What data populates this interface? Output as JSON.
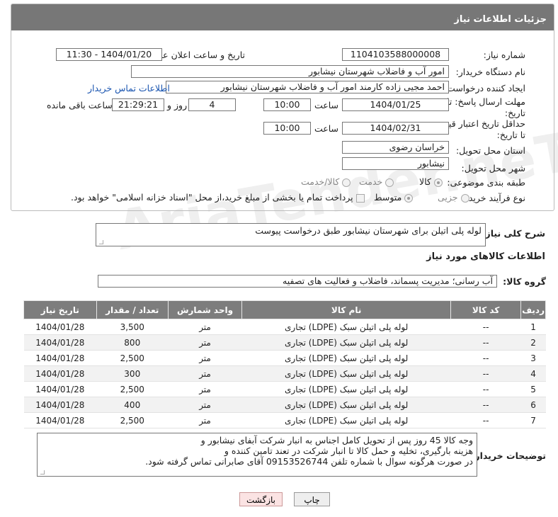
{
  "header": {
    "title": "جزئیات اطلاعات نیاز"
  },
  "fields": {
    "need_number_label": "شماره نیاز:",
    "need_number": "1104103588000008",
    "announce_label": "تاریخ و ساعت اعلان عمومی:",
    "announce_value": "1404/01/20 - 11:30",
    "buyer_org_label": "نام دستگاه خریدار:",
    "buyer_org": "امور آب و فاضلاب شهرستان نیشابور",
    "creator_label": "ایجاد کننده درخواست:",
    "creator": "احمد مجیی زاده کارمند امور آب و فاضلاب شهرستان نیشابور",
    "contact_link": "اطلاعات تماس خریدار",
    "deadline_label_1": "مهلت ارسال پاسخ: تا",
    "deadline_label_2": "تاریخ:",
    "deadline_date": "1404/01/25",
    "time_label": "ساعت",
    "deadline_time": "10:00",
    "days_value": "4",
    "days_label": "روز و",
    "remaining_time": "21:29:21",
    "remaining_label": "ساعت باقی مانده",
    "price_label_1": "حداقل تاریخ اعتبار قیمت:",
    "price_label_2": "تا تاریخ:",
    "price_date": "1404/02/31",
    "price_time": "10:00",
    "province_label": "استان محل تحویل:",
    "province": "خراسان رضوی",
    "city_label": "شهر محل تحویل:",
    "city": "نیشابور",
    "category_label": "طبقه بندی موضوعی:",
    "category_options": [
      "کالا",
      "خدمت",
      "کالا/خدمت"
    ],
    "process_label": "نوع فرآیند خرید :",
    "process_options": [
      "جزیی",
      "متوسط"
    ],
    "payment_note": "پرداخت تمام یا بخشی از مبلغ خرید،از محل \"اسناد خزانه اسلامی\" خواهد بود."
  },
  "description": {
    "label": "شرح کلی نیاز:",
    "text": "لوله پلی اتیلن برای شهرستان نیشابور طبق درخواست پیوست"
  },
  "goods": {
    "section_title": "اطلاعات کالاهای مورد نیاز",
    "group_label": "گروه کالا:",
    "group_value": "آب رسانی؛ مدیریت پسماند، فاضلاب و فعالیت های تصفیه",
    "columns": [
      "ردیف",
      "کد کالا",
      "نام کالا",
      "واحد شمارش",
      "تعداد / مقدار",
      "تاریخ نیاز"
    ],
    "rows": [
      [
        "1",
        "--",
        "لوله پلی اتیلن سبک (LDPE) تجاری",
        "متر",
        "3,500",
        "1404/01/28"
      ],
      [
        "2",
        "--",
        "لوله پلی اتیلن سبک (LDPE) تجاری",
        "متر",
        "800",
        "1404/01/28"
      ],
      [
        "3",
        "--",
        "لوله پلی اتیلن سبک (LDPE) تجاری",
        "متر",
        "2,500",
        "1404/01/28"
      ],
      [
        "4",
        "--",
        "لوله پلی اتیلن سبک (LDPE) تجاری",
        "متر",
        "300",
        "1404/01/28"
      ],
      [
        "5",
        "--",
        "لوله پلی اتیلن سبک (LDPE) تجاری",
        "متر",
        "2,500",
        "1404/01/28"
      ],
      [
        "6",
        "--",
        "لوله پلی اتیلن سبک (LDPE) تجاری",
        "متر",
        "400",
        "1404/01/28"
      ],
      [
        "7",
        "--",
        "لوله پلی اتیلن سبک (LDPE) تجاری",
        "متر",
        "2,500",
        "1404/01/28"
      ]
    ]
  },
  "buyer_notes": {
    "label": "توضیحات خریدار:",
    "lines": [
      "وجه کالا 45 روز پس از تحویل کامل اجناس به انبار شرکت آبفای نیشابور و",
      "هزینه بارگیری، تخلیه و حمل کالا تا انبار شرکت در تعند تامین کننده و",
      "در صورت هرگونه سوال با شماره تلفن 09153526744 آقای صابرانی تماس گرفته شود."
    ]
  },
  "buttons": {
    "print": "چاپ",
    "back": "بازگشت"
  },
  "watermark": "AriaTender.neT"
}
